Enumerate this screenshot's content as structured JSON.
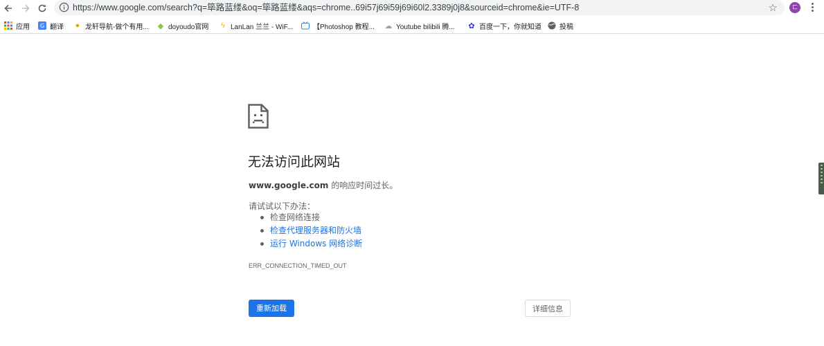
{
  "toolbar": {
    "url": "https://www.google.com/search?q=筚路蓝缕&oq=筚路蓝缕&aqs=chrome..69i57j69i59j69i60l2.3389j0j8&sourceid=chrome&ie=UTF-8",
    "avatar_text": "ㄈ"
  },
  "bookmarks": {
    "apps": "应用",
    "items": [
      {
        "label": "翻译"
      },
      {
        "label": "龙轩导航-做个有用..."
      },
      {
        "label": "doyoudo官网"
      },
      {
        "label": "LanLan 兰兰 - WiF..."
      },
      {
        "label": "【Photoshop 教程..."
      },
      {
        "label": "Youtube bilibili 腾..."
      },
      {
        "label": "百度一下，你就知道"
      },
      {
        "label": "投稿"
      }
    ]
  },
  "error": {
    "title": "无法访问此网站",
    "host": "www.google.com",
    "summary_suffix": " 的响应时间过长。",
    "try_label": "请试试以下办法：",
    "suggestions": [
      "检查网络连接",
      "检查代理服务器和防火墙",
      "运行 Windows 网络诊断"
    ],
    "code": "ERR_CONNECTION_TIMED_OUT",
    "reload_label": "重新加载",
    "details_label": "详细信息"
  },
  "colors": {
    "accent": "#1a73e8",
    "text_secondary": "#5f6368"
  }
}
